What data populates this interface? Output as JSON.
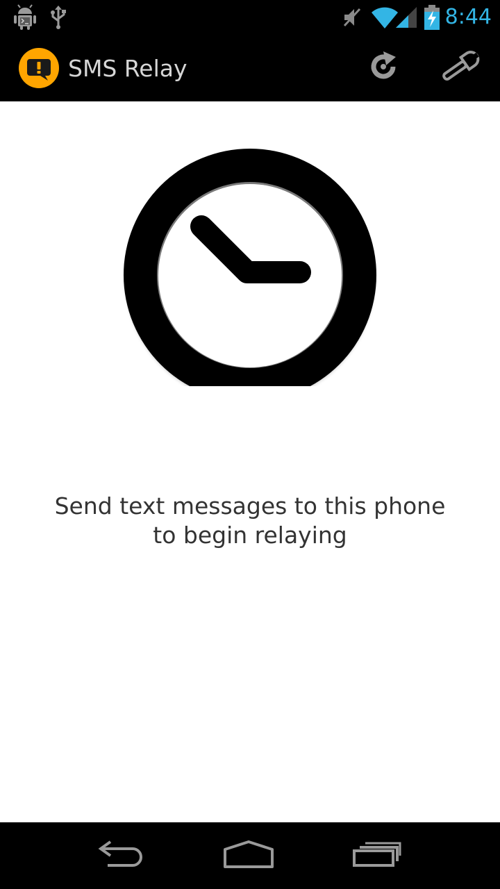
{
  "status_bar": {
    "time": "8:44",
    "time_color": "#33b5e5",
    "left_icons": [
      "android-debug-icon",
      "usb-icon"
    ],
    "right_icons": [
      "mute-icon",
      "wifi-icon",
      "signal-icon",
      "battery-charging-icon"
    ]
  },
  "action_bar": {
    "title": "SMS Relay",
    "app_icon": "sms-relay-app-icon",
    "app_icon_color": "#ffa500",
    "actions": [
      {
        "name": "refresh",
        "icon": "refresh-icon"
      },
      {
        "name": "settings",
        "icon": "wrench-icon"
      }
    ]
  },
  "main": {
    "illustration": "clock-icon",
    "message": "Send text messages to this phone to begin relaying"
  },
  "nav_bar": {
    "buttons": [
      {
        "name": "back",
        "icon": "back-icon"
      },
      {
        "name": "home",
        "icon": "home-icon"
      },
      {
        "name": "recents",
        "icon": "recent-apps-icon"
      }
    ]
  }
}
